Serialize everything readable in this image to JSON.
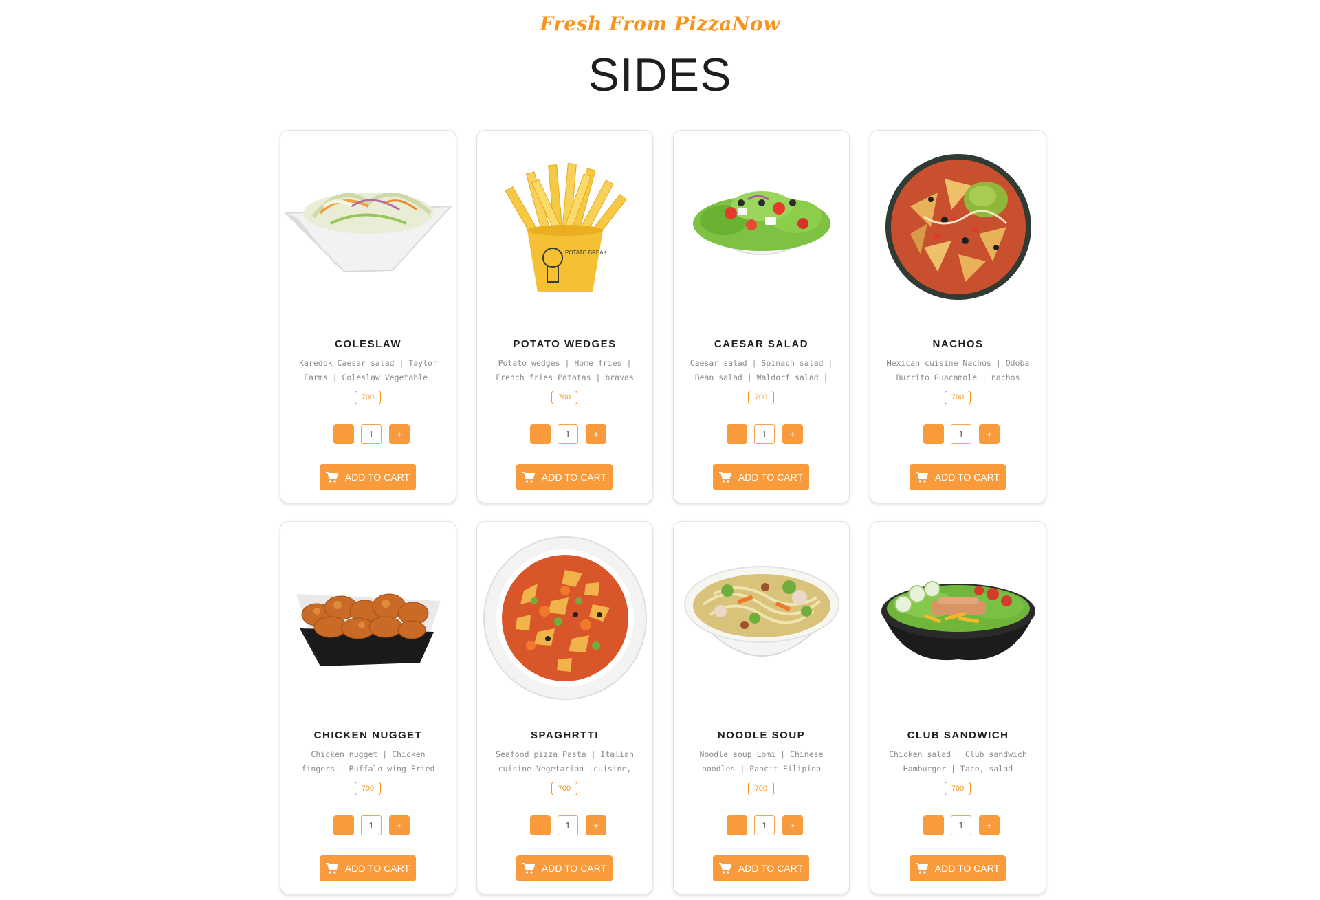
{
  "header": {
    "tagline": "Fresh From PizzaNow",
    "title": "SIDES"
  },
  "theme": {
    "accent": "#f99a3c",
    "accent_text": "#f7941d"
  },
  "cart_label": "ADD TO CART",
  "products": [
    {
      "name": "COLESLAW",
      "desc": "Karedok Caesar salad | Taylor Farms | Coleslaw Vegetable| Avocado salad",
      "price": "700",
      "qty": "1",
      "minus": "-",
      "plus": "+",
      "image": "coleslaw-bowl"
    },
    {
      "name": "POTATO WEDGES",
      "desc": "Potato wedges | Home fries | French fries Patatas | bravas Lyonnaise...",
      "price": "700",
      "qty": "1",
      "minus": "-",
      "plus": "+",
      "image": "fries-cup"
    },
    {
      "name": "CAESAR SALAD",
      "desc": "Caesar salad | Spinach salad | Bean salad | Waldorf salad | Fattoush...",
      "price": "700",
      "qty": "1",
      "minus": "-",
      "plus": "+",
      "image": "salad-bowl"
    },
    {
      "name": "NACHOS",
      "desc": "Mexican cuisine Nachos | Qdoba Burrito Guacamole | nachos",
      "price": "700",
      "qty": "1",
      "minus": "-",
      "plus": "+",
      "image": "nachos-plate"
    },
    {
      "name": "CHICKEN NUGGET",
      "desc": "Chicken nugget | Chicken fingers | Buffalo wing Fried chicken Krystal ..",
      "price": "700",
      "qty": "1",
      "minus": "-",
      "plus": "+",
      "image": "nugget-tray"
    },
    {
      "name": "SPAGHRTTI",
      "desc": "Seafood pizza Pasta | Italian cuisine Vegetarian |cuisine, spagetti",
      "price": "700",
      "qty": "1",
      "minus": "-",
      "plus": "+",
      "image": "pasta-plate"
    },
    {
      "name": "NOODLE SOUP",
      "desc": "Noodle soup Lomi | Chinese noodles | Pancit Filipino cuisine| cooking",
      "price": "700",
      "qty": "1",
      "minus": "-",
      "plus": "+",
      "image": "soup-bowl"
    },
    {
      "name": "CLUB SANDWICH",
      "desc": "Chicken salad | Club sandwich Hamburger | Taco, salad",
      "price": "700",
      "qty": "1",
      "minus": "-",
      "plus": "+",
      "image": "chicken-salad-bowl"
    }
  ]
}
